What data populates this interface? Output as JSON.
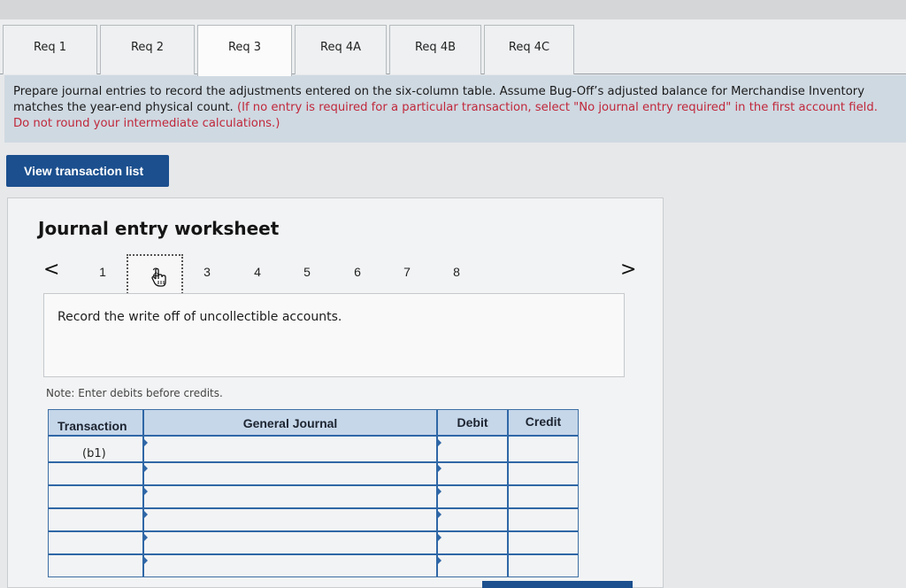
{
  "tabs": [
    {
      "label": "Req 1"
    },
    {
      "label": "Req 2"
    },
    {
      "label": "Req 3"
    },
    {
      "label": "Req 4A"
    },
    {
      "label": "Req 4B"
    },
    {
      "label": "Req 4C"
    }
  ],
  "active_tab": "Req 3",
  "prompt": {
    "main": "Prepare journal entries to record the adjustments entered on the six-column table. Assume Bug-Off’s adjusted balance for Merchandise Inventory matches the year-end physical count. ",
    "instruction": "(If no entry is required for a particular transaction, select \"No journal entry required\" in the first account field. Do not round your intermediate calculations.)"
  },
  "view_transaction_button": "View transaction list",
  "worksheet": {
    "title": "Journal entry worksheet",
    "prev_arrow": "<",
    "next_arrow": ">",
    "pages": [
      "1",
      "2",
      "3",
      "4",
      "5",
      "6",
      "7",
      "8"
    ],
    "current_page": "2",
    "description": "Record the write off of uncollectible accounts.",
    "note": "Note: Enter debits before credits."
  },
  "journal_table": {
    "headers": {
      "transaction": "Transaction",
      "general_journal": "General Journal",
      "debit": "Debit",
      "credit": "Credit"
    },
    "rows": [
      {
        "transaction": "(b1)",
        "account": "",
        "debit": "",
        "credit": ""
      },
      {
        "transaction": "",
        "account": "",
        "debit": "",
        "credit": ""
      },
      {
        "transaction": "",
        "account": "",
        "debit": "",
        "credit": ""
      },
      {
        "transaction": "",
        "account": "",
        "debit": "",
        "credit": ""
      },
      {
        "transaction": "",
        "account": "",
        "debit": "",
        "credit": ""
      },
      {
        "transaction": "",
        "account": "",
        "debit": "",
        "credit": ""
      }
    ]
  },
  "colors": {
    "accent": "#1b4f8e",
    "table_border": "#2f67a6",
    "header_bg": "#c6d7ea",
    "instruction_red": "#c0283b"
  }
}
